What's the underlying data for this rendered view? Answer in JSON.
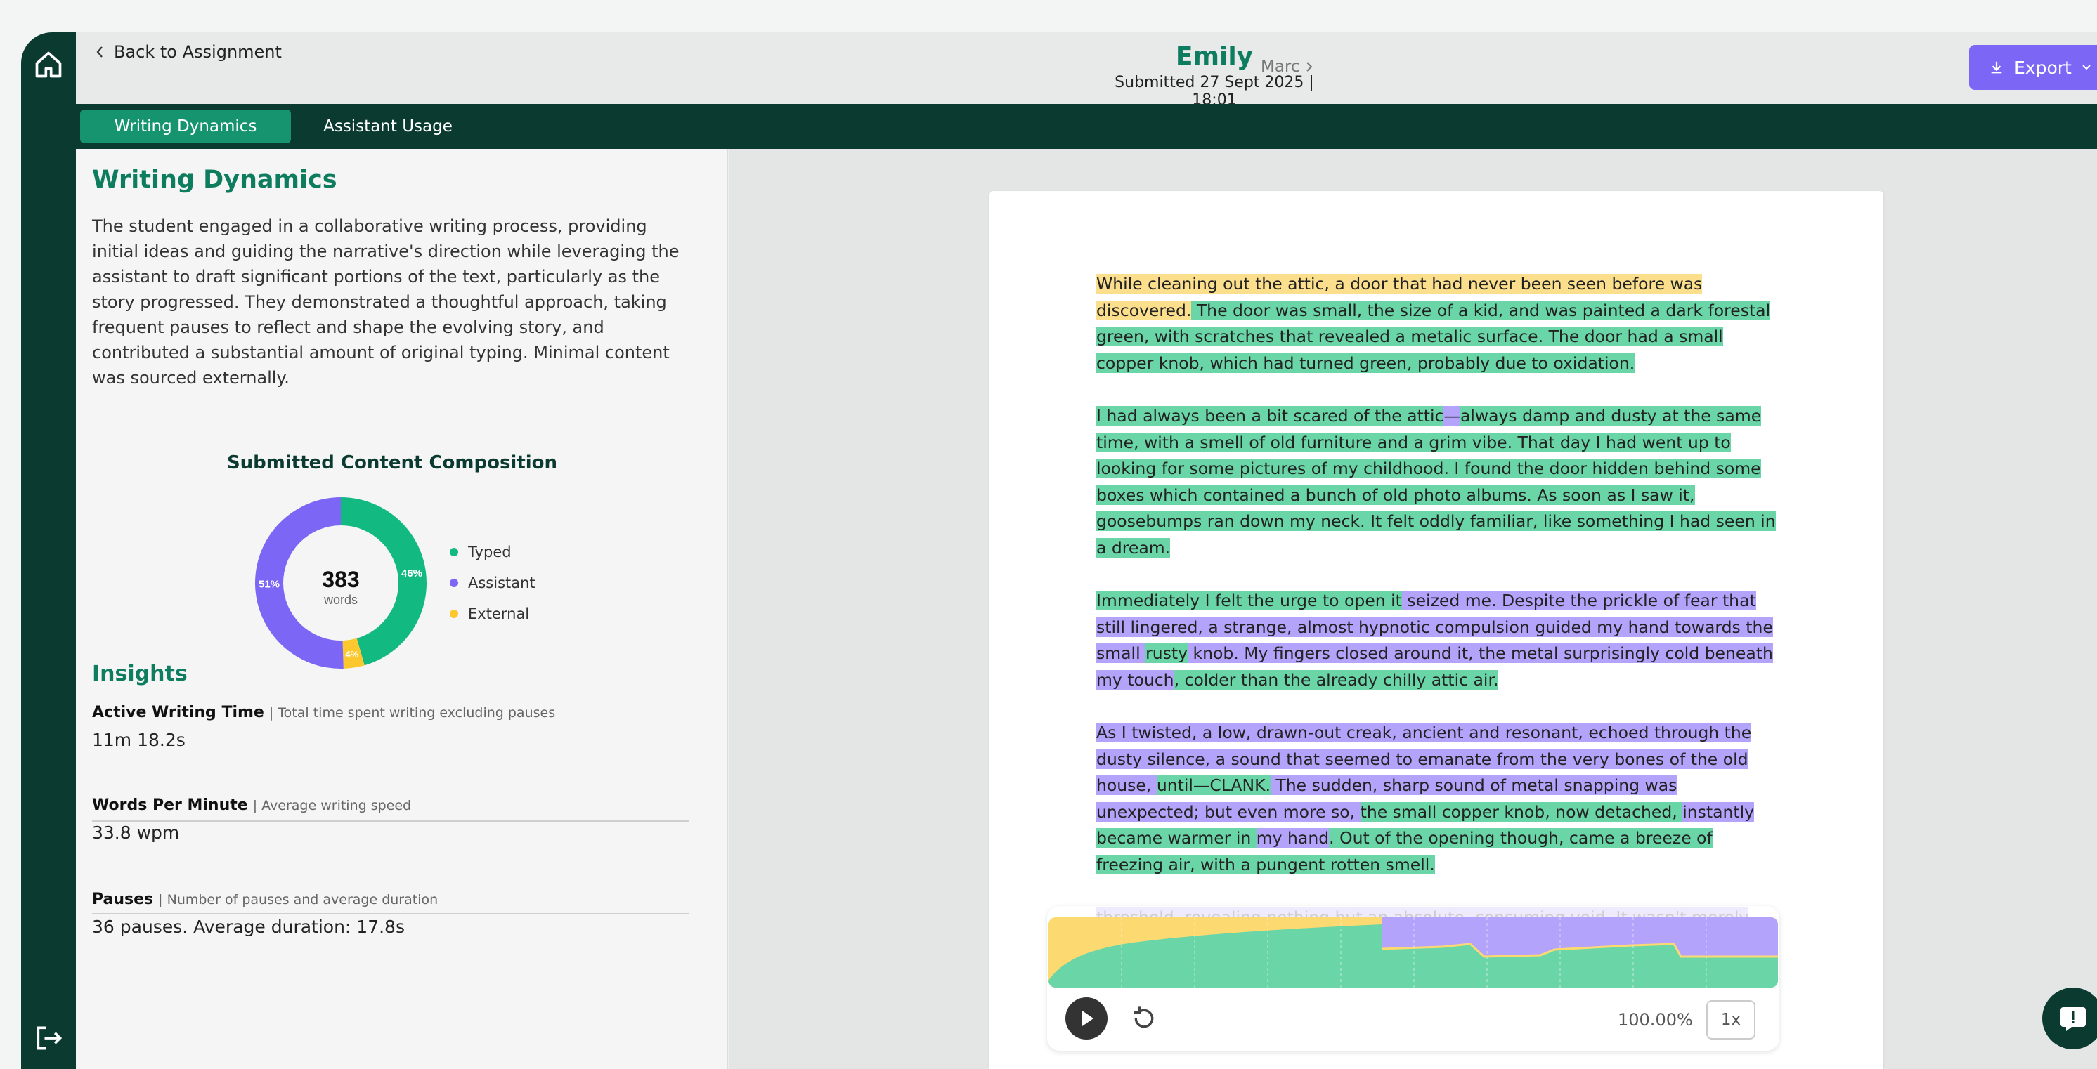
{
  "header": {
    "back_label": "Back to Assignment",
    "student_name": "Emily",
    "submitted": "Submitted 27 Sept 2025 | 18:01",
    "next_student": "Marc",
    "export_label": "Export"
  },
  "tabs": [
    {
      "label": "Writing Dynamics",
      "active": true
    },
    {
      "label": "Assistant Usage",
      "active": false
    }
  ],
  "panel": {
    "title": "Writing Dynamics",
    "summary": "The student engaged in a collaborative writing process, providing initial ideas and guiding the narrative's direction while leveraging the assistant to draft significant portions of the text, particularly as the story progressed. They demonstrated a thoughtful approach, taking frequent pauses to reflect and shape the evolving story, and contributed a substantial amount of original typing. Minimal content was sourced externally."
  },
  "chart_data": {
    "type": "pie",
    "title": "Submitted Content Composition",
    "center_value": "383",
    "center_label": "words",
    "categories": [
      "Typed",
      "Assistant",
      "External"
    ],
    "values": [
      46,
      51,
      4
    ],
    "value_labels": [
      "46%",
      "51%",
      "4%"
    ],
    "colors": [
      "#12b981",
      "#7b66f5",
      "#fcc82d"
    ],
    "legend": "right"
  },
  "insights": {
    "title": "Insights",
    "metrics": [
      {
        "label": "Active Writing Time",
        "desc": "Total time spent writing excluding pauses",
        "value": "11m 18.2s"
      },
      {
        "label": "Words Per Minute",
        "desc": "Average writing speed",
        "value": "33.8 wpm"
      },
      {
        "label": "Pauses",
        "desc": "Number of pauses and average duration",
        "value": "36 pauses. Average duration: 17.8s"
      }
    ]
  },
  "document": {
    "paragraphs": [
      [
        [
          "y",
          "While cleaning out the attic, a door that had never been seen before was discovered."
        ],
        [
          "g",
          " The door was small, the size of a kid, and was painted a dark forestal green, with scratches that revealed a metalic surface. The door had a small copper knob, which had turned green, probably due to oxidation."
        ]
      ],
      [
        [
          "g",
          "I had always been a bit scared of the attic"
        ],
        [
          "p",
          "—"
        ],
        [
          "g",
          "always damp and dusty at the same time, with a smell of old furniture and a grim vibe. That day I had went up to looking for some pictures of my childhood. I found the door hidden behind some boxes which contained a bunch of old photo albums. As soon as I saw it, goosebumps ran down my neck. It felt oddly familiar, like something I had seen in a dream."
        ]
      ],
      [
        [
          "g",
          "Immediately I felt the urge to open it"
        ],
        [
          "p",
          " seized me. Despite the prickle of fear that still lingered, a strange, almost hypnotic compulsion guided my hand towards the small "
        ],
        [
          "g",
          "rusty"
        ],
        [
          "p",
          " knob. My fingers closed around it, the metal surprisingly cold beneath my touch"
        ],
        [
          "g",
          ", colder than the already chilly attic air."
        ]
      ],
      [
        [
          "p",
          "As I twisted, a low, drawn-out creak, ancient and resonant, echoed through the dusty silence, a sound that seemed to emanate from the very bones of the old house, "
        ],
        [
          "g",
          "until—CLANK."
        ],
        [
          "p",
          " The sudden, sharp sound of metal snapping was unexpected; but even more so, "
        ],
        [
          "g",
          "the small copper knob, now detached, "
        ],
        [
          "p",
          "instantly"
        ],
        [
          "g",
          " became warmer in "
        ],
        [
          "p",
          "my hand"
        ],
        [
          "g",
          ". Out of the opening though, came a breeze of freezing air, with a pungent rotten smell."
        ]
      ],
      [
        [
          "p",
          "threshold, revealing nothing but an absolute, consuming void. It wasn't merely dark; it was an absence of all light, all form, all dimension, a silent, suffocating expanse that seemed to pull at the very fabric of my being. Despite the primal"
        ]
      ]
    ]
  },
  "player": {
    "progress": "100.00%",
    "speed": "1x"
  },
  "colors": {
    "brand_dark": "#0b3a30",
    "brand_green": "#0e7d5f",
    "accent": "#7b66f5",
    "typed_highlight": "#6ad6a8",
    "assistant_highlight": "#b3a3fb",
    "external_highlight": "#fbdf8d"
  }
}
